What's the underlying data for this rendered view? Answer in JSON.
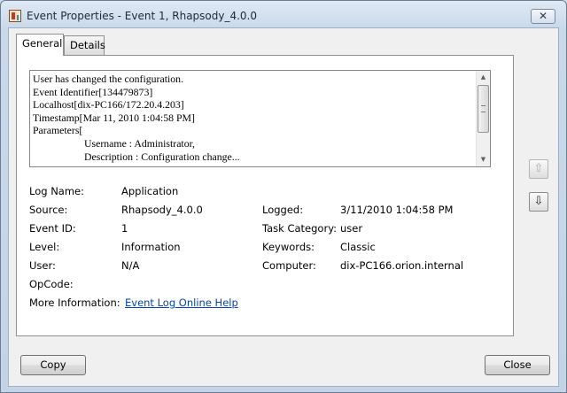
{
  "window": {
    "title": "Event Properties - Event 1, Rhapsody_4.0.0",
    "close_glyph": "✕"
  },
  "tabs": [
    {
      "label": "General",
      "active": true
    },
    {
      "label": "Details",
      "active": false
    }
  ],
  "message": {
    "lines": [
      "User has changed the configuration.",
      "",
      "Event Identifier[134479873]",
      "Localhost[dix-PC166/172.20.4.203]",
      "Timestamp[Mar 11, 2010 1:04:58 PM]",
      "Parameters[",
      "Username : Administrator,",
      "Description : Configuration change..."
    ],
    "scroll": {
      "up_glyph": "▲",
      "down_glyph": "▼"
    }
  },
  "fields": {
    "log_name": {
      "label": "Log Name:",
      "value": "Application"
    },
    "source": {
      "label": "Source:",
      "value": "Rhapsody_4.0.0"
    },
    "logged": {
      "label": "Logged:",
      "value": "3/11/2010 1:04:58 PM"
    },
    "event_id": {
      "label": "Event ID:",
      "value": "1"
    },
    "task_category": {
      "label": "Task Category:",
      "value": "user"
    },
    "level": {
      "label": "Level:",
      "value": "Information"
    },
    "keywords": {
      "label": "Keywords:",
      "value": "Classic"
    },
    "user": {
      "label": "User:",
      "value": "N/A"
    },
    "computer": {
      "label": "Computer:",
      "value": "dix-PC166.orion.internal"
    },
    "opcode": {
      "label": "OpCode:",
      "value": ""
    },
    "more_info": {
      "label": "More Information:",
      "link": "Event Log Online Help"
    }
  },
  "nav": {
    "up_glyph": "⇧",
    "down_glyph": "⇩"
  },
  "buttons": {
    "copy": "Copy",
    "close": "Close"
  },
  "colors": {
    "link": "#0645ad",
    "titlebar": "#cfdcea"
  }
}
